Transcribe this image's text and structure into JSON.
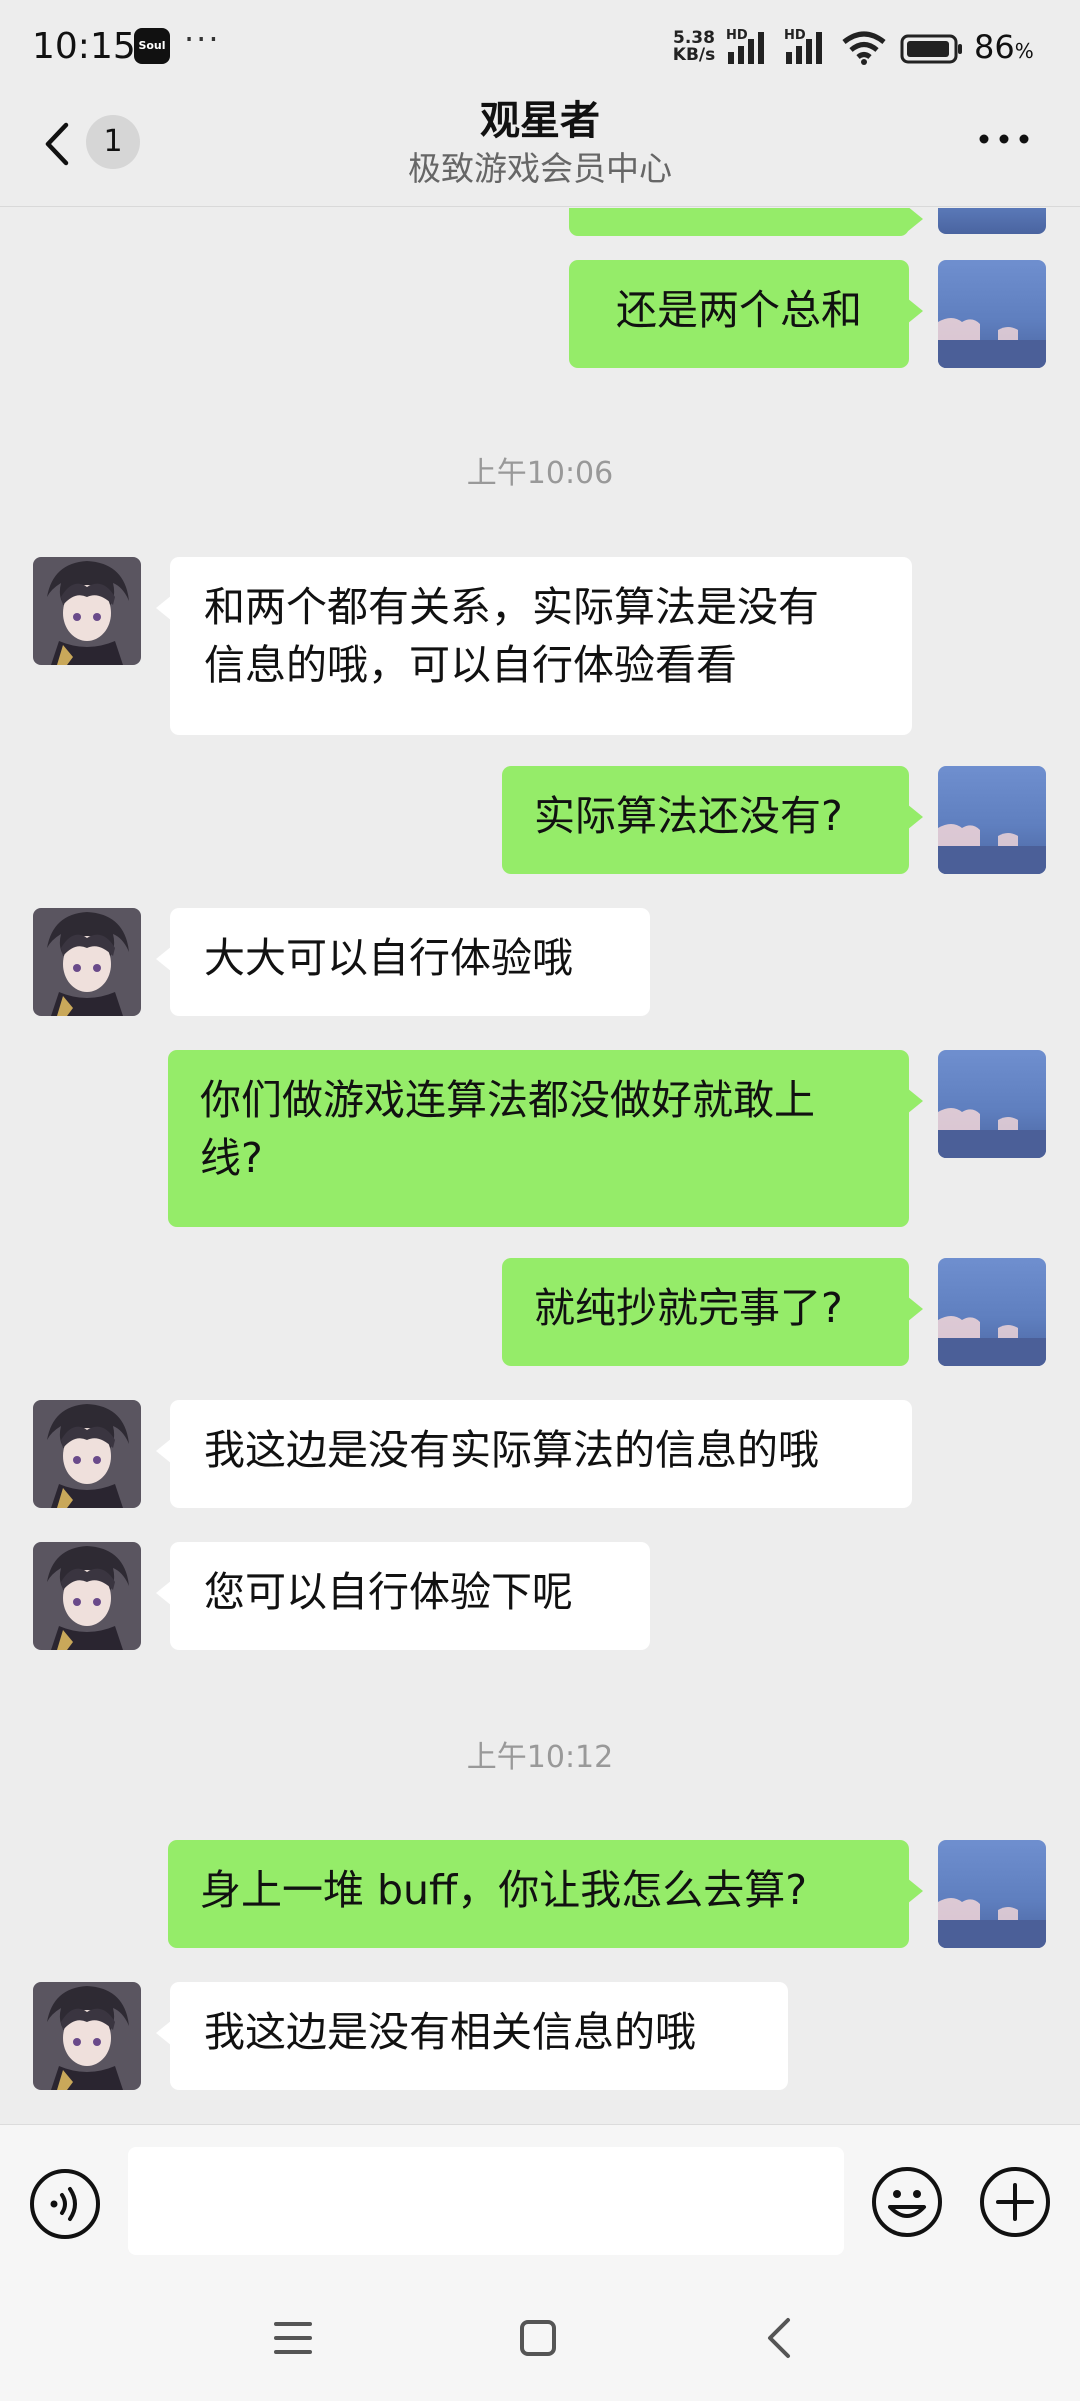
{
  "status_bar": {
    "time": "10:15",
    "app_icon_label": "Soul",
    "more_dots": "···",
    "net_speed_value": "5.38",
    "net_speed_unit": "KB/s",
    "hd_label": "HD",
    "battery_percent": "86",
    "battery_unit": "%",
    "icons": [
      "signal-icon",
      "wifi-icon",
      "battery-icon"
    ]
  },
  "header": {
    "unread_count": "1",
    "title": "观星者",
    "subtitle": "极致游戏会员中心"
  },
  "messages": [
    {
      "sender": "me",
      "text": ""
    },
    {
      "sender": "me",
      "text": "还是两个总和"
    },
    {
      "type": "time",
      "text": "上午10:06"
    },
    {
      "sender": "them",
      "lines": [
        "和两个都有关系，实际算法是没有",
        "信息的哦，可以自行体验看看"
      ]
    },
    {
      "sender": "me",
      "text": "实际算法还没有?"
    },
    {
      "sender": "them",
      "text": "大大可以自行体验哦"
    },
    {
      "sender": "me",
      "lines": [
        "你们做游戏连算法都没做好就敢上",
        "线?"
      ]
    },
    {
      "sender": "me",
      "text": "就纯抄就完事了?"
    },
    {
      "sender": "them",
      "text": "我这边是没有实际算法的信息的哦"
    },
    {
      "sender": "them",
      "text": "您可以自行体验下呢"
    },
    {
      "type": "time",
      "text": "上午10:12"
    },
    {
      "sender": "me",
      "text": "身上一堆 buff，你让我怎么去算?"
    },
    {
      "sender": "them",
      "text": "我这边是没有相关信息的哦"
    }
  ],
  "input_bar": {
    "value": "",
    "placeholder": ""
  },
  "colors": {
    "outgoing_bubble": "#95ec69",
    "incoming_bubble": "#ffffff",
    "background": "#ededed"
  }
}
